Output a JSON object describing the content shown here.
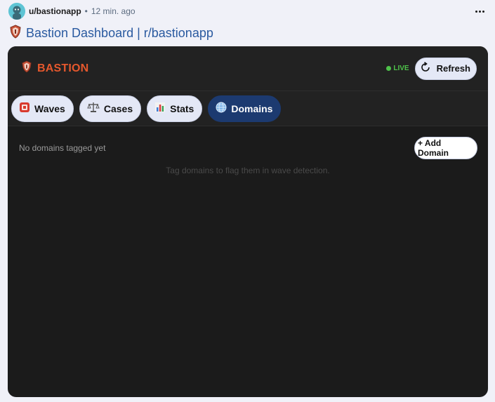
{
  "post": {
    "username": "u/bastionapp",
    "separator": "•",
    "time": "12 min. ago",
    "title": "Bastion Dashboard | r/bastionapp"
  },
  "app": {
    "brand": "BASTION",
    "live": "LIVE",
    "refresh_label": "Refresh",
    "tabs": [
      {
        "label": "Waves",
        "icon": "wave-alert-icon"
      },
      {
        "label": "Cases",
        "icon": "scales-icon"
      },
      {
        "label": "Stats",
        "icon": "bar-chart-icon"
      },
      {
        "label": "Domains",
        "icon": "globe-icon",
        "active": true
      }
    ],
    "domains": {
      "empty_title": "No domains tagged yet",
      "add_label": "+ Add Domain",
      "empty_hint": "Tag domains to flag them in wave detection."
    }
  },
  "colors": {
    "brand": "#e5582d",
    "live": "#4ec24a",
    "active_tab": "#1c3a70",
    "app_bg": "#1b1b1b",
    "title_link": "#2a5aa0"
  }
}
